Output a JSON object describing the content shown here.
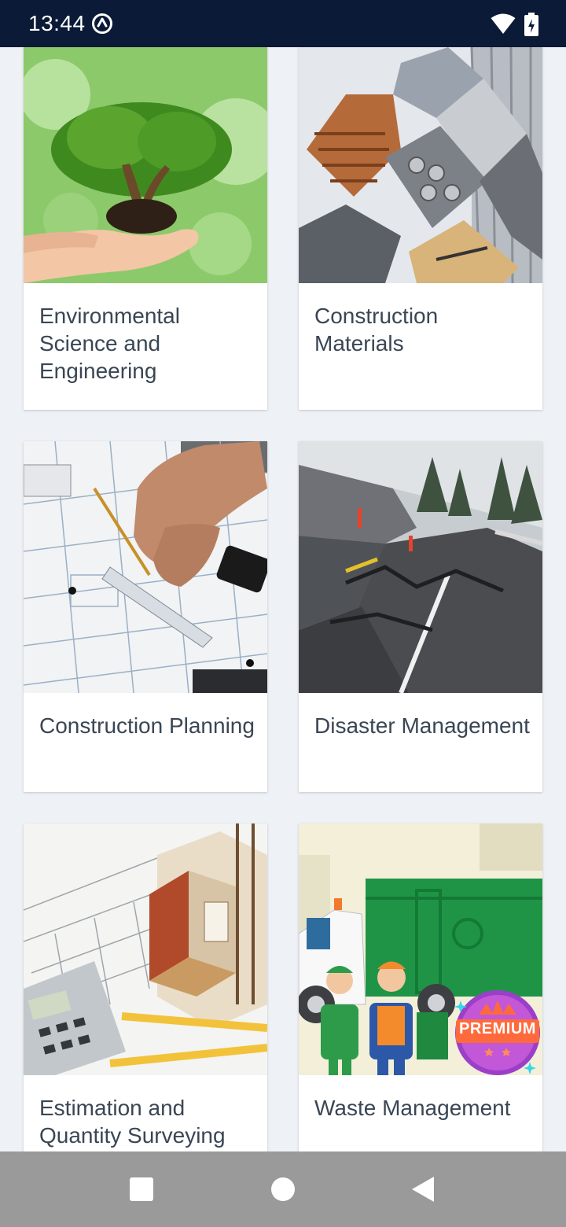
{
  "status_bar": {
    "time": "13:44",
    "icons": [
      "app-notification-icon",
      "wifi-icon",
      "battery-charging-icon"
    ]
  },
  "courses": [
    {
      "title": "Environmental Science and Engineering",
      "image": "tree-in-hands-image"
    },
    {
      "title": "Construction Materials",
      "image": "materials-collage-image"
    },
    {
      "title": "Construction Planning",
      "image": "blueprint-drafting-image"
    },
    {
      "title": "Disaster Management",
      "image": "cracked-road-image"
    },
    {
      "title": "Estimation and Quantity Surveying",
      "image": "house-model-calculator-image"
    },
    {
      "title": "Waste Management",
      "image": "garbage-truck-workers-image"
    }
  ],
  "premium": {
    "label": "PREMIUM"
  },
  "nav_bar": {
    "icons": [
      "recents-icon",
      "home-icon",
      "back-icon"
    ]
  },
  "colors": {
    "status_bar": "#0b1a36",
    "background": "#eef1f5",
    "card": "#ffffff",
    "title_text": "#3a4654",
    "nav_bar": "#9a9a9a",
    "premium_orange": "#ff6a3d",
    "premium_purple": "#9b3fc8"
  }
}
